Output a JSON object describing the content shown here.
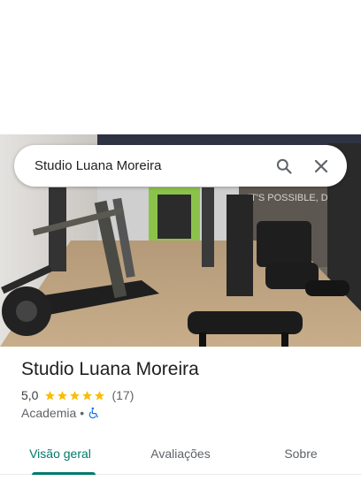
{
  "search": {
    "query": "Studio Luana Moreira",
    "search_icon": "search-icon",
    "close_icon": "close-icon"
  },
  "photo": {
    "wall_text": "IT'S POSSIBLE, DO IT."
  },
  "place": {
    "name": "Studio Luana Moreira",
    "rating": "5,0",
    "stars": 5,
    "review_count": "(17)",
    "category": "Academia",
    "separator": "•",
    "accessibility_icon": "wheelchair-icon"
  },
  "tabs": [
    {
      "label": "Visão geral",
      "active": true
    },
    {
      "label": "Avaliações",
      "active": false
    },
    {
      "label": "Sobre",
      "active": false
    }
  ],
  "colors": {
    "accent": "#00796b",
    "star": "#fbbc04",
    "accessible_blue": "#1a73e8"
  }
}
